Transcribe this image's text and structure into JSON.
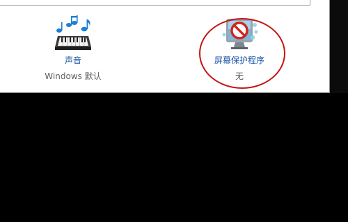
{
  "items": [
    {
      "label": "声音",
      "sublabel": "Windows 默认",
      "icon": "sound-keyboard-notes-icon"
    },
    {
      "label": "屏幕保护程序",
      "sublabel": "无",
      "icon": "screensaver-disabled-icon"
    }
  ],
  "colors": {
    "link": "#1e57a8",
    "sub": "#5f5f5f",
    "highlight_circle": "#c41515",
    "background": "#000000",
    "window": "#ffffff"
  }
}
